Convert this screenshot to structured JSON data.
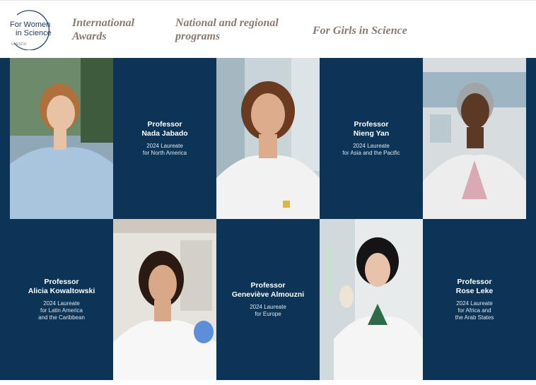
{
  "logo": {
    "line1": "For Women",
    "line2": "in Science",
    "brand": "UNESCO"
  },
  "nav": [
    {
      "label_1": "International",
      "label_2": "Awards"
    },
    {
      "label_1": "National and regional",
      "label_2": "programs"
    },
    {
      "label_1": "For Girls in Science",
      "label_2": ""
    }
  ],
  "laureates": [
    {
      "title": "Professor",
      "name": "Nada Jabado",
      "year": "2024 Laureate",
      "region": "for North America"
    },
    {
      "title": "Professor",
      "name": "Nieng Yan",
      "year": "2024 Laureate",
      "region": "for Asia and the Pacific"
    },
    {
      "title": "Professor",
      "name": "Alicia Kowaltowski",
      "year": "2024 Laureate",
      "region": "for Latin America\nand the Caribbean"
    },
    {
      "title": "Professor",
      "name": "Geneviève Almouzni",
      "year": "2024 Laureate",
      "region": "for Europe"
    },
    {
      "title": "Professor",
      "name": "Rose Leke",
      "year": "2024 Laureate",
      "region": "for Africa and\nthe Arab States"
    }
  ],
  "colors": {
    "navy": "#0b3457",
    "nav_text": "#8a7a70"
  }
}
